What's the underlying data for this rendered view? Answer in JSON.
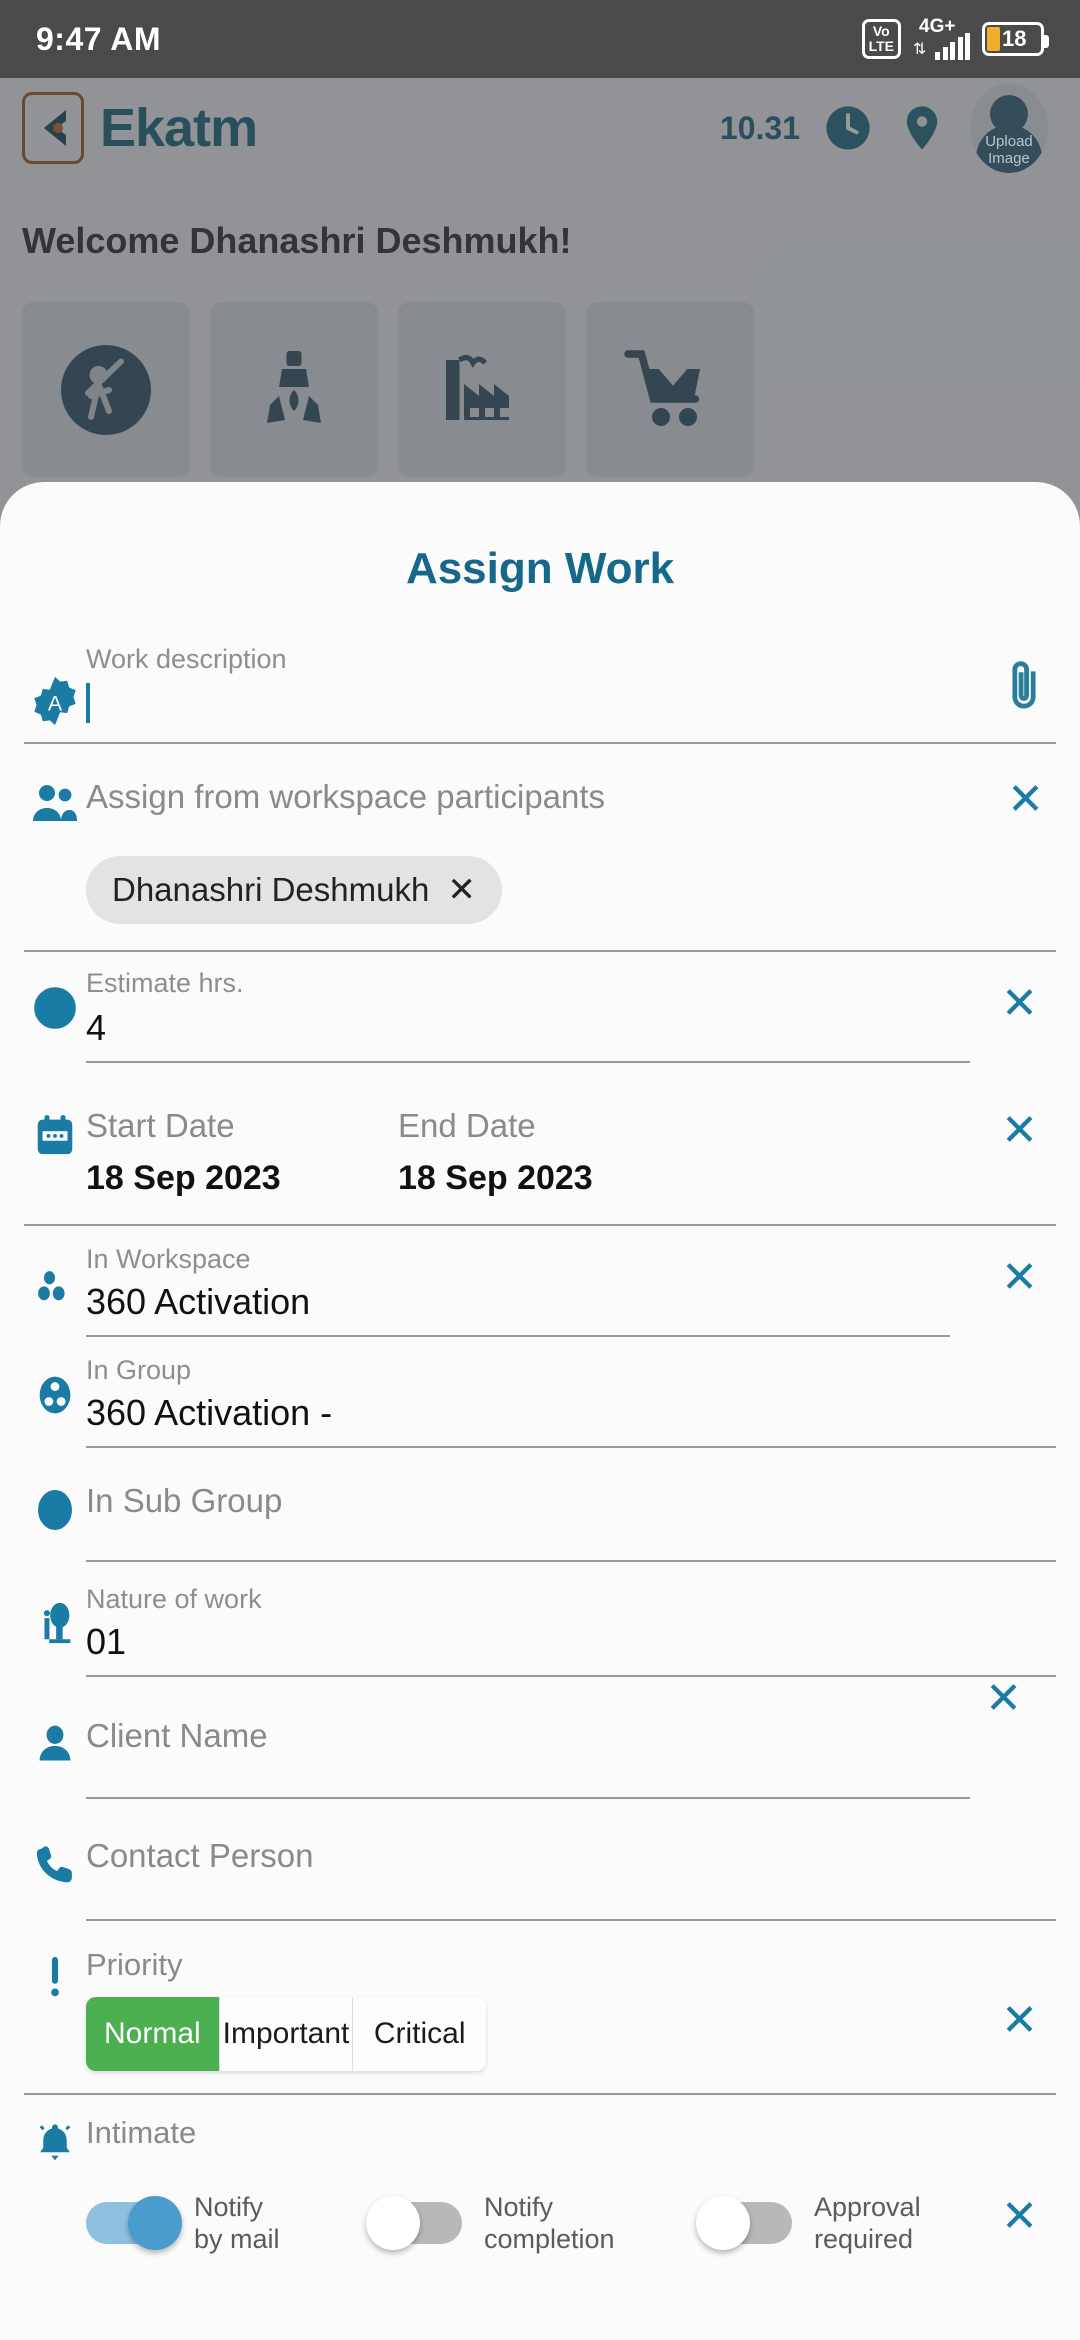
{
  "status_bar": {
    "time": "9:47 AM",
    "volte_line1": "Vo",
    "volte_line2": "LTE",
    "network": "4G+",
    "battery_percent": "18"
  },
  "app_header": {
    "brand": "Ekatm",
    "counter": "10.31",
    "avatar_line1": "Upload",
    "avatar_line2": "Image",
    "back_icon": "back-arrow-icon",
    "clock_icon": "clock-icon",
    "location_icon": "location-pin-icon"
  },
  "app_body": {
    "welcome": "Welcome Dhanashri Deshmukh!",
    "tiles": [
      {
        "icon": "achievement-person-icon"
      },
      {
        "icon": "team-network-icon"
      },
      {
        "icon": "factory-icon"
      },
      {
        "icon": "shopping-cart-download-icon"
      }
    ]
  },
  "modal": {
    "title": "Assign Work",
    "work_description": {
      "label": "Work description",
      "value": "",
      "icon": "badge-a-icon",
      "attach_icon": "paperclip-icon"
    },
    "assign_participants": {
      "placeholder": "Assign from workspace participants",
      "icon": "people-icon",
      "clear_label": "✕",
      "chips": [
        {
          "name": "Dhanashri Deshmukh",
          "remove_label": "✕"
        }
      ]
    },
    "estimate_hours": {
      "label": "Estimate hrs.",
      "value": "4",
      "icon": "clock-icon",
      "clear_label": "✕"
    },
    "dates": {
      "start_label": "Start Date",
      "start_value": "18 Sep 2023",
      "end_label": "End Date",
      "end_value": "18 Sep 2023",
      "icon": "calendar-icon",
      "clear_label": "✕"
    },
    "in_workspace": {
      "label": "In Workspace",
      "value": "360 Activation",
      "icon": "workspace-dots-icon",
      "clear_label": "✕"
    },
    "in_group": {
      "label": "In Group",
      "value": "360 Activation -",
      "icon": "group-circle-icon"
    },
    "in_sub_group": {
      "placeholder": "In Sub Group",
      "value": "",
      "icon": "subgroup-circle-icon"
    },
    "nature_of_work": {
      "label": "Nature of work",
      "value": "01",
      "icon": "tree-icon"
    },
    "client_name": {
      "placeholder": "Client Name",
      "value": "",
      "icon": "person-icon",
      "clear_label": "✕"
    },
    "contact_person": {
      "placeholder": "Contact Person",
      "value": "",
      "icon": "phone-icon"
    },
    "priority": {
      "label": "Priority",
      "icon": "exclamation-icon",
      "clear_label": "✕",
      "options": [
        "Normal",
        "Important",
        "Critical"
      ],
      "selected": "Normal"
    },
    "intimate": {
      "label": "Intimate",
      "icon": "bell-icon",
      "clear_label": "✕",
      "toggles": [
        {
          "line1": "Notify",
          "line2": "by mail",
          "state": "on"
        },
        {
          "line1": "Notify",
          "line2": "completion",
          "state": "off"
        },
        {
          "line1": "Approval",
          "line2": "required",
          "state": "off"
        }
      ]
    }
  },
  "colors": {
    "accent_teal": "#1a7ba4",
    "brand_teal": "#16637d",
    "priority_green": "#4caf50",
    "toggle_on": "#4a9ccc",
    "status_bar": "#4a4a4a"
  }
}
